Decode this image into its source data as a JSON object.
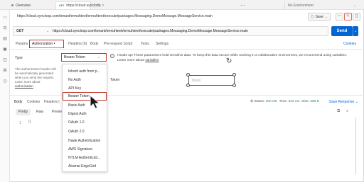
{
  "tabs": {
    "overview": "Overview",
    "active_method": "GET",
    "active_url": "https://cloud.syncloop",
    "close": "×",
    "add": "+",
    "more": "⋯",
    "environment": "No Environment"
  },
  "breadcrumb": "https://cloud.syncloop.com/tenant/ermuhteet/ermuhteet/execute/packages.Messaging.DemoMessage.MessageService.main",
  "toolbar": {
    "save_label": "Save"
  },
  "request": {
    "method": "GET",
    "url": "https://cloud.syncloop.com/tenant/ermuhteet/ermuhteet/execute/packages.Messaging.DemoMessage.MessageService.main",
    "send_label": "Send"
  },
  "request_tabs": [
    "Params",
    "Authorization •",
    "Headers (6)",
    "Body",
    "Pre-request Script",
    "Tests",
    "Settings"
  ],
  "cookies_label": "Cookies",
  "auth": {
    "type_label": "Type",
    "selected_type": "Bearer Token",
    "description_1": "The authorization header will be automatically generated when you send the request. Learn more about",
    "description_link": "authorization",
    "notice_text": "Heads up! These parameters hold sensitive data. To keep this data secure while working in a collaborative environment, we recommend using variables. Learn more about",
    "notice_link": "variables",
    "token_label": "Token",
    "token_placeholder": "Token"
  },
  "auth_options": [
    "Inherit auth from p...",
    "No Auth",
    "API Key",
    "Bearer Token",
    "Basic Auth",
    "Digest Auth",
    "OAuth 1.0",
    "OAuth 2.0",
    "Hawk Authentication",
    "AWS Signature",
    "NTLM Authenticati...",
    "Akamai EdgeGrid"
  ],
  "response": {
    "tabs": [
      "Body",
      "Cookies",
      "Headers (",
      "Test Results"
    ],
    "status_label": "Status:",
    "status_value": "200 OK",
    "time_label": "Time:",
    "time_value": "610 ms",
    "size_label": "Size:",
    "size_value": "399 B",
    "save_response": "Save Response",
    "format_buttons": [
      "Pretty",
      "Raw",
      "Previe"
    ],
    "line_number": "1",
    "code": "{}"
  }
}
